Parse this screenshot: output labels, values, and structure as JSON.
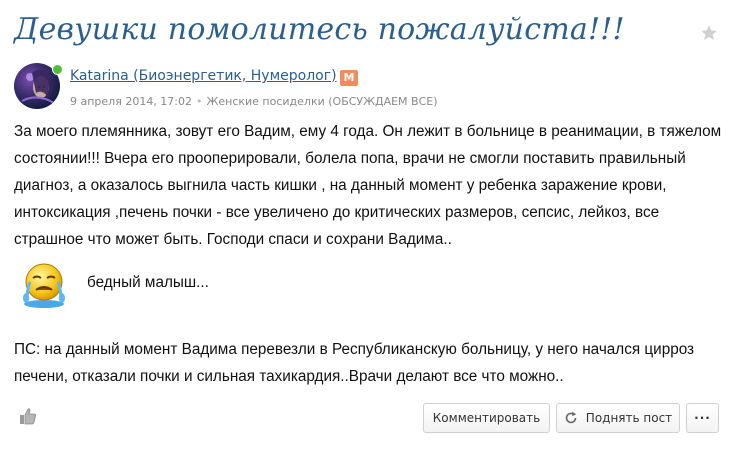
{
  "post": {
    "title": "Девушки помолитесь пожалуйста!!!",
    "author": "Katarina (Биоэнергетик, Нумеролог)",
    "badge": "М",
    "date": "9 апреля 2014, 17:02",
    "category": "Женские посиделки (ОБСУЖДАЕМ ВСЕ)",
    "body": "За моего племянника, зовут его Вадим, ему 4 года. Он лежит в больнице в реанимации, в тяжелом состоянии!!! Вчера его прооперировали, болела попа, врачи не смогли поставить правильный диагноз, а оказалось  выгнила часть кишки , на данный момент у ребенка заражение крови, интоксикация ,печень почки - все увеличено до критических размеров, сепсис, лейкоз, все страшное что может быть. Господи спаси и сохрани Вадима..",
    "emoji_caption": "бедный малыш...",
    "ps": "ПС: на данный момент Вадима перевезли в Республиканскую больницу, у него начался цирроз печени, отказали почки и сильная тахикардия..Врачи делают все что можно.."
  },
  "actions": {
    "comment_label": "Комментировать",
    "raise_label": "Поднять пост",
    "more_label": "···"
  },
  "icons": {
    "favorite": "star-icon",
    "like": "thumbs-up-icon",
    "raise": "refresh-icon",
    "emoji": "crying-smiley-icon"
  },
  "colors": {
    "title": "#2b5f8f",
    "badge": "#f28c5c",
    "online": "#4fbf3a"
  }
}
